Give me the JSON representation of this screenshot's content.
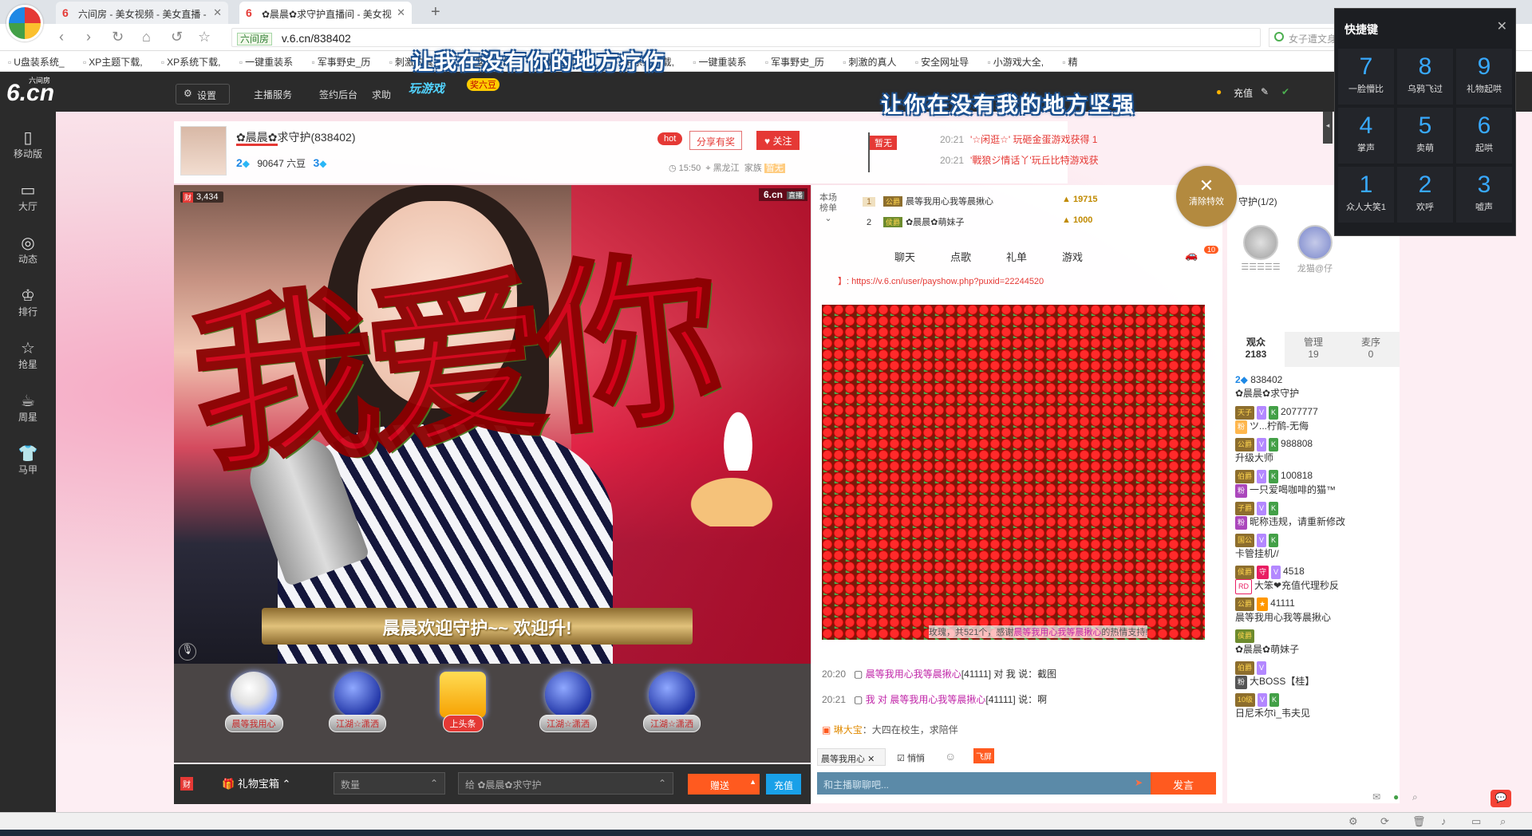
{
  "browser": {
    "tabs": [
      {
        "label": "六间房 - 美女视频 - 美女直播 - "
      },
      {
        "label": "✿晨晨✿求守护直播间 - 美女视"
      }
    ],
    "url_site": "六间房",
    "url_path": "v.6.cn/838402",
    "search_placeholder": "女子遭文身男猥亵",
    "bookmarks": [
      "U盘装系统_",
      "XP主题下载,",
      "XP系统下载,",
      "一键重装系",
      "军事野史_历",
      "刺激的真人",
      "U盘装系统_",
      "XP主题下载,",
      "XP系统下载,",
      "一键重装系",
      "军事野史_历",
      "刺激的真人",
      "安全网址导",
      "小游戏大全,",
      "精"
    ]
  },
  "site_header": {
    "logo": "6.cn",
    "logo_small": "六间房",
    "settings": "设置",
    "nav": [
      "主播服务",
      "签约后台",
      "求助"
    ],
    "game_label": "玩游戏",
    "game_badge": "奖六豆",
    "recharge": "充值"
  },
  "lyrics": {
    "line1": "让我在没有你的地方疗伤",
    "line2": "让你在没有我的地方坚强"
  },
  "sidebar": {
    "items": [
      {
        "icon": "mobile-icon",
        "label": "移动版"
      },
      {
        "icon": "tv-icon",
        "label": "大厅"
      },
      {
        "icon": "compass-icon",
        "label": "动态"
      },
      {
        "icon": "crown-icon",
        "label": "排行"
      },
      {
        "icon": "star-icon",
        "label": "抢星"
      },
      {
        "icon": "cup-icon",
        "label": "周星"
      },
      {
        "icon": "shirt-icon",
        "label": "马甲"
      }
    ]
  },
  "anchor": {
    "name": "✿晨晨✿求守护(838402)",
    "level": "2",
    "beans": "90647 六豆",
    "level2": "3",
    "hot": "hot",
    "share": "分享有奖",
    "follow": "关注",
    "time": "15:50",
    "location": "黑龙江",
    "family": "家族",
    "family_badge": "暂无",
    "flag": "暂无"
  },
  "news": [
    {
      "time": "20:21",
      "text": "'☆闲逛☆' 玩砸金蛋游戏获得 1"
    },
    {
      "time": "20:21",
      "text": "'戰狼ジ情话丫'玩丘比特游戏获"
    }
  ],
  "video": {
    "rich_count": "3,434",
    "live_logo": "6.cn",
    "live_tag": "直播",
    "banner": "晨晨欢迎守护~~  欢迎升!",
    "rose_text": "我爱你"
  },
  "gifts": [
    {
      "label": "晨等我用心"
    },
    {
      "label": "江湖☆潇洒"
    },
    {
      "label": "上头条"
    },
    {
      "label": "江湖☆潇洒"
    },
    {
      "label": "江湖☆潇洒"
    }
  ],
  "gift_bar": {
    "cai": "财",
    "box": "礼物宝箱",
    "qty_placeholder": "数量",
    "to": "给 ✿晨晨✿求守护",
    "send": "赠送",
    "recharge": "充值"
  },
  "rank": {
    "tab": "本场榜单",
    "rows": [
      {
        "n": "1",
        "name": "晨等我用心我等晨揪心",
        "pts": "19715"
      },
      {
        "n": "2",
        "name": "✿晨晨✿萌妹子",
        "pts": "1000"
      }
    ]
  },
  "chat_tabs": [
    "聊天",
    "点歌",
    "礼单",
    "游戏"
  ],
  "car_badge": "10",
  "clear_effect": "清除特效",
  "chat": {
    "link": "】: https://v.6.cn/user/payshow.php?puxid=22244520",
    "thanks_prefix": "玫瑰，共521个，感谢",
    "thanks_user": "晨等我用心我等晨揪心",
    "thanks_suffix": "的热情支持!",
    "messages": [
      {
        "time": "20:20",
        "user": "晨等我用心我等晨揪心",
        "rest": "[41111] 对 我 说：截图"
      },
      {
        "time": "20:21",
        "user": "我 对 晨等我用心我等晨揪心",
        "rest": "[41111] 说：啊"
      }
    ],
    "announce_user": "琳大宝",
    "announce_text": "：大四在校生，求陪伴",
    "target": "晨等我用心",
    "quiet": "悄悄",
    "input_placeholder": "和主播聊聊吧...",
    "speak": "发言"
  },
  "guard": {
    "title": "守护(1/2)",
    "avatars": [
      "☰☰☰☰☰",
      "龙猫@仔"
    ]
  },
  "audience": {
    "tabs": [
      {
        "label": "观众",
        "count": "2183"
      },
      {
        "label": "管理",
        "count": "19"
      },
      {
        "label": "麦序",
        "count": "0"
      }
    ],
    "items": [
      {
        "id": "838402",
        "name": "✿晨晨✿求守护"
      },
      {
        "id": "2077777",
        "name": "ツ...柠鸸-无侮"
      },
      {
        "id": "988808",
        "name": "升级大师"
      },
      {
        "id": "100818",
        "name": "一只爱喝咖啡的猫™"
      },
      {
        "id": "",
        "name": "昵称违规，请重新修改"
      },
      {
        "id": "",
        "name": "卡管挂机//"
      },
      {
        "id": "4518",
        "name": "大笨❤充值代理秒反"
      },
      {
        "id": "41111",
        "name": "晨等我用心我等晨揪心"
      },
      {
        "id": "",
        "name": "✿晨晨✿萌妹子"
      },
      {
        "id": "",
        "name": "大BOSS【桂】"
      },
      {
        "id": "",
        "name": "日尼禾尔ì_韦夫见"
      }
    ]
  },
  "shortcuts": {
    "title": "快捷键",
    "keys": [
      {
        "num": "7",
        "label": "一脸懵比"
      },
      {
        "num": "8",
        "label": "乌鸦飞过"
      },
      {
        "num": "9",
        "label": "礼物起哄"
      },
      {
        "num": "4",
        "label": "掌声"
      },
      {
        "num": "5",
        "label": "卖萌"
      },
      {
        "num": "6",
        "label": "起哄"
      },
      {
        "num": "1",
        "label": "众人大笑1"
      },
      {
        "num": "2",
        "label": "欢呼"
      },
      {
        "num": "3",
        "label": "嘘声"
      }
    ]
  }
}
